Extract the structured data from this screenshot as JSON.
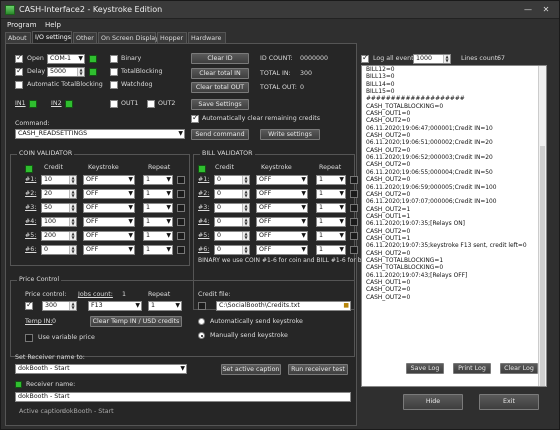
{
  "window": {
    "title": "CASH-Interface2 - Keystroke Edition",
    "minimize": "—",
    "close": "✕"
  },
  "menu": [
    "Program",
    "Help"
  ],
  "tabs": [
    "About",
    "I/O settings",
    "Other",
    "On Screen Display",
    "Hopper",
    "Hardware"
  ],
  "io": {
    "open_label": "Open",
    "port": "COM-1",
    "delay_label": "Delay",
    "delay_value": "5000",
    "auto_totalblocking": "Automatic TotalBlocking",
    "binary": "Binary",
    "totalblocking": "TotalBlocking",
    "watchdog": "Watchdog",
    "in1": "IN1",
    "in2": "IN2",
    "out1": "OUT1",
    "out2": "OUT2",
    "clear_id": "Clear ID",
    "clear_total_in": "Clear total IN",
    "clear_total_out": "Clear total OUT",
    "save_settings": "Save Settings",
    "id_count_label": "ID COUNT:",
    "id_count_value": "0000000",
    "total_in_label": "TOTAL IN:",
    "total_in_value": "300",
    "total_out_label": "TOTAL OUT:",
    "total_out_value": "0",
    "auto_clear": "Automatically clear remaining credits",
    "command_label": "Command:",
    "command_value": "CASH_READSETTINGS",
    "send_command": "Send command",
    "write_settings": "Write settings"
  },
  "coin": {
    "title": "COIN VALIDATOR",
    "credit_h": "Credit",
    "keystroke_h": "Keystroke",
    "repeat_h": "Repeat",
    "rows": [
      {
        "label": "#1:",
        "credit": "10",
        "key": "OFF",
        "repeat": "1"
      },
      {
        "label": "#2:",
        "credit": "20",
        "key": "OFF",
        "repeat": "1"
      },
      {
        "label": "#3:",
        "credit": "50",
        "key": "OFF",
        "repeat": "1"
      },
      {
        "label": "#4:",
        "credit": "100",
        "key": "OFF",
        "repeat": "1"
      },
      {
        "label": "#5:",
        "credit": "200",
        "key": "OFF",
        "repeat": "1"
      },
      {
        "label": "#6:",
        "credit": "0",
        "key": "OFF",
        "repeat": "1"
      }
    ]
  },
  "bill": {
    "title": "BILL VALIDATOR",
    "credit_h": "Credit",
    "keystroke_h": "Keystroke",
    "repeat_h": "Repeat",
    "rows": [
      {
        "label": "#1:",
        "credit": "0",
        "key": "OFF",
        "repeat": "1"
      },
      {
        "label": "#2:",
        "credit": "0",
        "key": "OFF",
        "repeat": "1"
      },
      {
        "label": "#3:",
        "credit": "0",
        "key": "OFF",
        "repeat": "1"
      },
      {
        "label": "#4:",
        "credit": "0",
        "key": "OFF",
        "repeat": "1"
      },
      {
        "label": "#5:",
        "credit": "0",
        "key": "OFF",
        "repeat": "1"
      },
      {
        "label": "#6:",
        "credit": "0",
        "key": "OFF",
        "repeat": "1"
      }
    ],
    "note": "BINARY we use COIN #1-6 for coin and BILL #1-6 for bill"
  },
  "price": {
    "title": "Price Control",
    "price_control_label": "Price control:",
    "jobs_count_label": "Jobs count:",
    "jobs_count_value": "1",
    "repeat_label": "Repeat",
    "price_value": "300",
    "key_value": "F13",
    "repeat_value": "1",
    "temp_in_label": "Temp IN:",
    "temp_in_value": "0",
    "clear_temp_btn": "Clear Temp IN / USD credits",
    "use_variable": "Use variable price",
    "credit_file_label": "Credit file:",
    "credit_file_value": "C:\\SocialBooth\\Credits.txt",
    "auto_send": "Automatically send keystroke",
    "manual_send": "Manually send keystroke"
  },
  "bottom": {
    "set_receiver_label": "Set Receiver name to:",
    "set_receiver_value": "dokBooth - Start",
    "set_active_caption": "Set active caption",
    "run_receiver_test": "Run receiver test",
    "receiver_name_label": "Receiver name:",
    "receiver_name_value": "dokBooth - Start",
    "active_caption_label": "Active caption:",
    "active_caption_value": "dokBooth - Start"
  },
  "log": {
    "log_all_label": "Log all events",
    "lines_value": "1000",
    "lines_count_label": "Lines count:",
    "lines_count_value": "67",
    "lines": [
      "BILL12=0",
      "BILL13=0",
      "BILL14=0",
      "BILL15=0",
      "####################",
      "CASH_TOTALBLOCKING=0",
      "CASH_OUT1=0",
      "CASH_OUT2=0",
      "06.11.2020;19:06:47;000001;Credit IN=10",
      "CASH_OUT2=0",
      "06.11.2020;19:06:51;000002;Credit IN=20",
      "CASH_OUT2=0",
      "06.11.2020;19:06:52;000003;Credit IN=20",
      "CASH_OUT2=0",
      "06.11.2020;19:06:55;000004;Credit IN=50",
      "CASH_OUT2=0",
      "06.11.2020;19:06:59;000005;Credit IN=100",
      "CASH_OUT2=0",
      "06.11.2020;19:07:07;000006;Credit IN=100",
      "CASH_OUT2=1",
      "CASH_OUT1=1",
      "06.11.2020;19:07:35;[Relays ON]",
      "CASH_OUT2=0",
      "CASH_OUT1=1",
      "06.11.2020;19:07:35;keystroke F13 sent, credit left=0",
      "CASH_OUT2=0",
      "CASH_TOTALBLOCKING=1",
      "CASH_TOTALBLOCKING=0",
      "06.11.2020;19:07:43;[Relays OFF]",
      "CASH_OUT1=0",
      "CASH_OUT2=0",
      "CASH_OUT2=0"
    ],
    "save_log": "Save Log",
    "print_log": "Print Log",
    "clear_log": "Clear Log",
    "hide": "Hide",
    "exit": "Exit"
  }
}
